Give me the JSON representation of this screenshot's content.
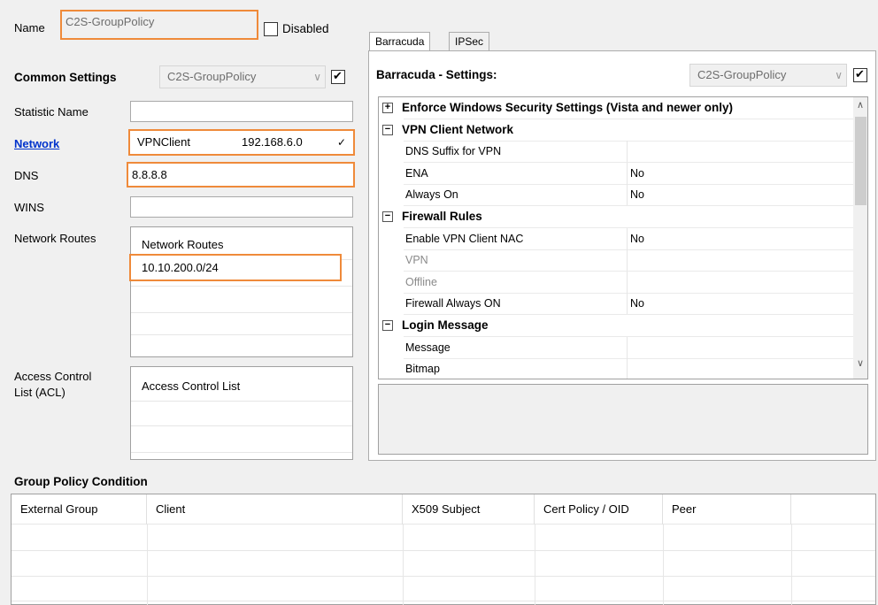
{
  "header": {
    "name_label": "Name",
    "name_value": "C2S-GroupPolicy",
    "disabled_label": "Disabled"
  },
  "common": {
    "title": "Common Settings",
    "combo_value": "C2S-GroupPolicy",
    "checked": true,
    "statistic_label": "Statistic Name",
    "statistic_value": "",
    "network_label": "Network",
    "network_name": "VPNClient",
    "network_ip": "192.168.6.0",
    "dns_label": "DNS",
    "dns_value": "8.8.8.8",
    "wins_label": "WINS",
    "wins_value": "",
    "routes_label": "Network Routes",
    "routes_header": "Network Routes",
    "routes": [
      "10.10.200.0/24"
    ],
    "acl_label_1": "Access Control",
    "acl_label_2": "List (ACL)",
    "acl_header": "Access Control List"
  },
  "tabs": [
    {
      "label": "Barracuda",
      "active": true
    },
    {
      "label": "IPSec",
      "active": false
    }
  ],
  "barracuda": {
    "title": "Barracuda - Settings:",
    "combo_value": "C2S-GroupPolicy",
    "checked": true,
    "rows": [
      {
        "type": "category",
        "expander": "⊞",
        "name": "Enforce Windows Security Settings (Vista and newer only)"
      },
      {
        "type": "category",
        "expander": "⊟",
        "name": "VPN Client Network"
      },
      {
        "type": "prop",
        "name": "DNS Suffix for VPN",
        "value": "",
        "grey": false
      },
      {
        "type": "prop",
        "name": "ENA",
        "value": "No",
        "grey": false
      },
      {
        "type": "prop",
        "name": "Always On",
        "value": "No",
        "grey": false
      },
      {
        "type": "category",
        "expander": "⊟",
        "name": "Firewall Rules"
      },
      {
        "type": "prop",
        "name": "Enable VPN Client NAC",
        "value": "No",
        "grey": false
      },
      {
        "type": "prop",
        "name": "VPN",
        "value": "",
        "grey": true
      },
      {
        "type": "prop",
        "name": "Offline",
        "value": "",
        "grey": true
      },
      {
        "type": "prop",
        "name": "Firewall Always ON",
        "value": "No",
        "grey": false
      },
      {
        "type": "category",
        "expander": "⊟",
        "name": "Login Message"
      },
      {
        "type": "prop",
        "name": "Message",
        "value": "",
        "grey": false
      },
      {
        "type": "prop",
        "name": "Bitmap",
        "value": "",
        "grey": false
      }
    ]
  },
  "condition": {
    "title": "Group Policy Condition",
    "columns": [
      "External Group",
      "Client",
      "X509 Subject",
      "Cert Policy / OID",
      "Peer"
    ]
  },
  "colors": {
    "highlight": "#ef8a3a",
    "link": "#0033cc"
  }
}
